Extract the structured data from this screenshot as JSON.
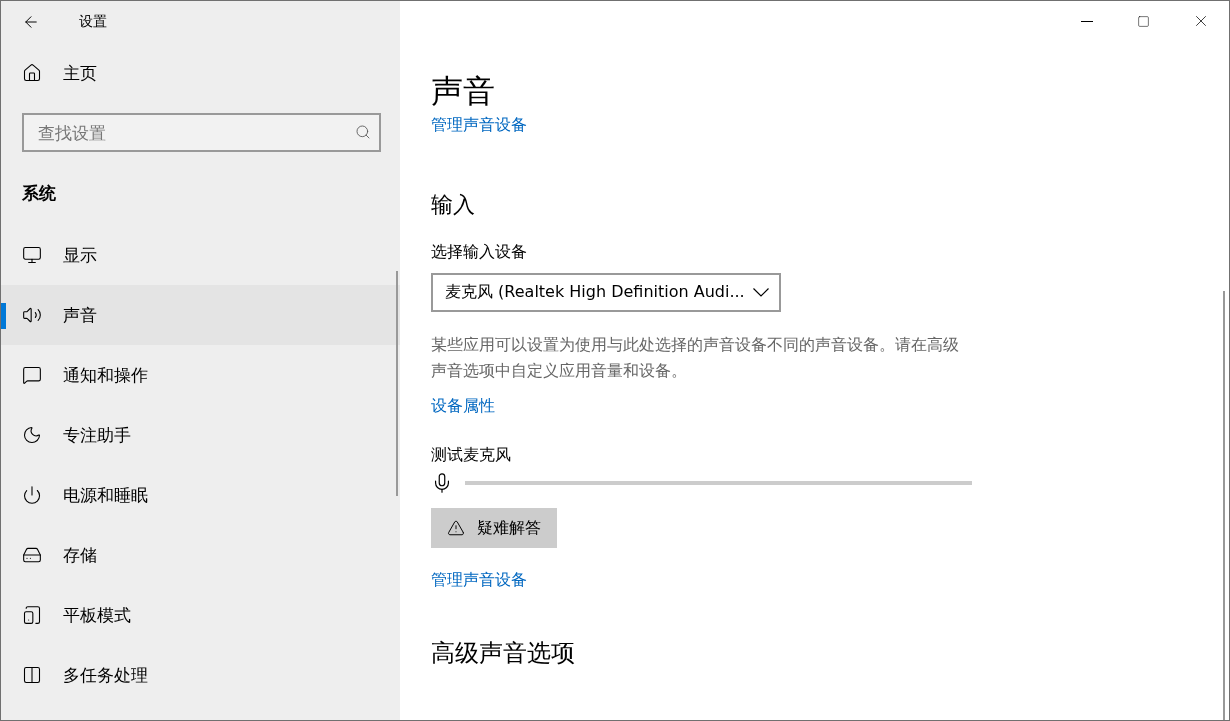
{
  "window": {
    "title": "设置"
  },
  "sidebar": {
    "home": "主页",
    "search": {
      "placeholder": "查找设置"
    },
    "section": "系统",
    "items": [
      {
        "label": "显示",
        "selected": false
      },
      {
        "label": "声音",
        "selected": true
      },
      {
        "label": "通知和操作",
        "selected": false
      },
      {
        "label": "专注助手",
        "selected": false
      },
      {
        "label": "电源和睡眠",
        "selected": false
      },
      {
        "label": "存储",
        "selected": false
      },
      {
        "label": "平板模式",
        "selected": false
      },
      {
        "label": "多任务处理",
        "selected": false
      }
    ]
  },
  "main": {
    "title": "声音",
    "top_link": "管理声音设备",
    "input_heading": "输入",
    "device_label": "选择输入设备",
    "device_value": "麦克风 (Realtek High Definition Audi...",
    "description": "某些应用可以设置为使用与此处选择的声音设备不同的声音设备。请在高级声音选项中自定义应用音量和设备。",
    "properties_link": "设备属性",
    "test_label": "测试麦克风",
    "mic_meter": {
      "level": 0
    },
    "troubleshoot_button": "疑难解答",
    "manage_link": "管理声音设备",
    "advanced_heading": "高级声音选项"
  }
}
